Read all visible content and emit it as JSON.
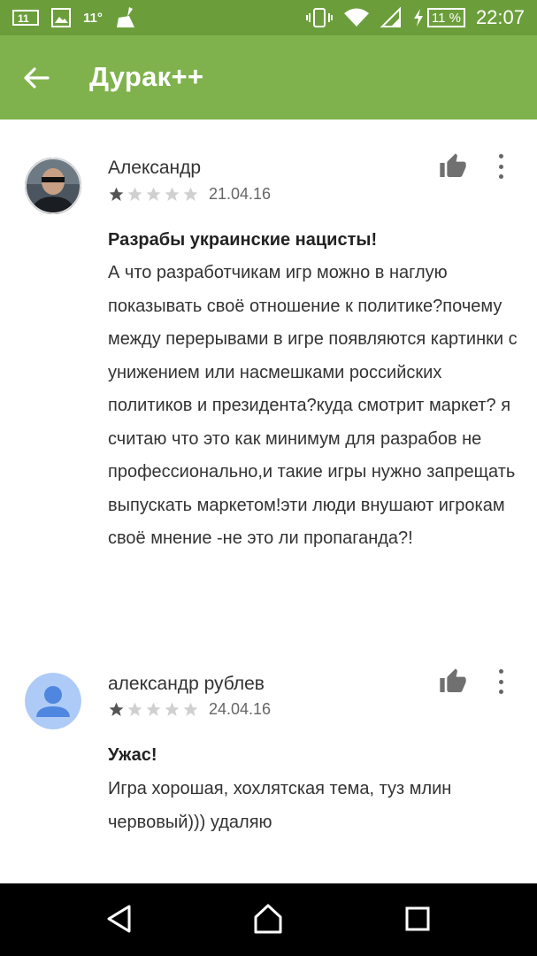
{
  "status_bar": {
    "notif_temp": "11°",
    "battery_percent": "11 %",
    "time": "22:07",
    "icons": [
      "sim-card-icon",
      "image-icon",
      "cleaning-broom-icon",
      "vibrate-icon",
      "wifi-icon",
      "cellular-signal-icon",
      "charging-bolt-icon",
      "battery-icon"
    ]
  },
  "app_bar": {
    "title": "Дурак++",
    "back_icon": "arrow-back-icon",
    "color": "#7fb24c"
  },
  "reviews": [
    {
      "author": "Александр",
      "rating": 1,
      "max_rating": 5,
      "date": "21.04.16",
      "title": "Разрабы украинские нацисты!",
      "body": "А что разработчикам игр можно в наглую показывать своё отношение к политике?почему между перерывами в игре появляются картинки с унижением или насмешками российских политиков и президента?куда смотрит маркет? я считаю что это как минимум для разрабов не профессионально,и такие игры нужно запрещать выпускать маркетом!эти люди внушают игрокам своё мнение -не это ли пропаганда?!"
    },
    {
      "author": "александр рублев",
      "rating": 1,
      "max_rating": 5,
      "date": "24.04.16",
      "title": "Ужас!",
      "body": "Игра хорошая, хохлятская тема, туз млин червовый))) удаляю"
    }
  ],
  "nav_bar": {
    "icons": [
      "nav-back-icon",
      "nav-home-icon",
      "nav-recents-icon"
    ]
  }
}
